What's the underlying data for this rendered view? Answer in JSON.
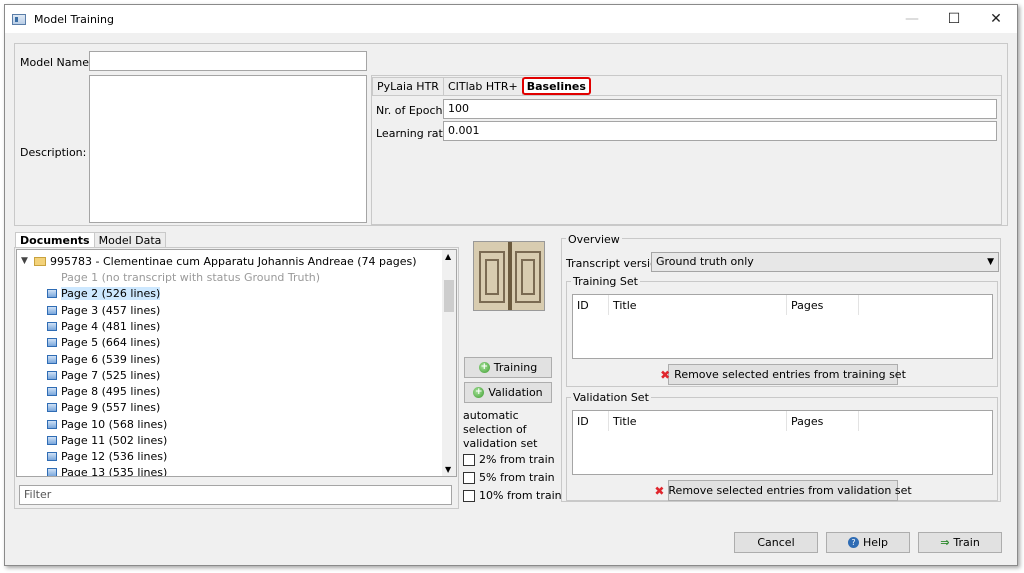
{
  "window": {
    "title": "Model Training",
    "min": "—",
    "max": "☐",
    "close": "✕"
  },
  "form": {
    "model_name_label": "Model Name:",
    "model_name_value": "",
    "description_label": "Description:",
    "description_value": ""
  },
  "engine_tabs": {
    "tabs": [
      "PyLaia HTR",
      "CITlab HTR+",
      "Baselines"
    ],
    "active": "Baselines"
  },
  "params": {
    "epochs_label": "Nr. of Epochs:",
    "epochs_value": "100",
    "lr_label": "Learning rate:",
    "lr_value": "0.001"
  },
  "doc_tabs": {
    "tabs": [
      "Documents",
      "Model Data"
    ]
  },
  "tree": {
    "root": "995783 - Clementinae cum Apparatu Johannis Andreae (74 pages)",
    "pages": [
      "Page 1 (no transcript with status Ground Truth)",
      "Page 2 (526 lines)",
      "Page 3 (457 lines)",
      "Page 4 (481 lines)",
      "Page 5 (664 lines)",
      "Page 6 (539 lines)",
      "Page 7 (525 lines)",
      "Page 8 (495 lines)",
      "Page 9 (557 lines)",
      "Page 10 (568 lines)",
      "Page 11 (502 lines)",
      "Page 12 (536 lines)",
      "Page 13 (535 lines)"
    ]
  },
  "filter_placeholder": "Filter",
  "assign": {
    "training_btn": "Training",
    "validation_btn": "Validation",
    "auto_label_1": "automatic",
    "auto_label_2": "selection of",
    "auto_label_3": "validation set",
    "opt_2": "2% from train",
    "opt_5": "5% from train",
    "opt_10": "10% from train"
  },
  "overview": {
    "title": "Overview",
    "transcript_label": "Transcript version",
    "transcript_value": "Ground truth only",
    "training_set_title": "Training Set",
    "validation_set_title": "Validation Set",
    "columns": [
      "ID",
      "Title",
      "Pages"
    ],
    "remove_training": "Remove selected entries from training set",
    "remove_validation": "Remove selected entries from validation set"
  },
  "footer": {
    "cancel": "Cancel",
    "help": "Help",
    "train": "Train"
  }
}
